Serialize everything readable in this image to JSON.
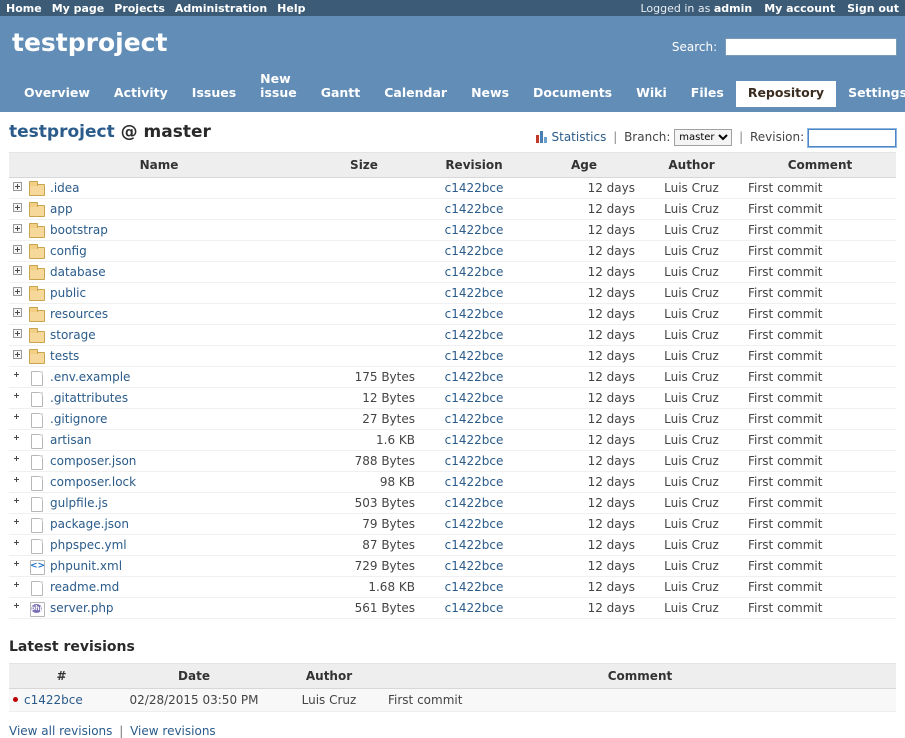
{
  "top_menu": {
    "left_items": [
      {
        "label": "Home",
        "name": "top-menu-home"
      },
      {
        "label": "My page",
        "name": "top-menu-my-page"
      },
      {
        "label": "Projects",
        "name": "top-menu-projects"
      },
      {
        "label": "Administration",
        "name": "top-menu-administration"
      },
      {
        "label": "Help",
        "name": "top-menu-help"
      }
    ],
    "logged_in_prefix": "Logged in as",
    "logged_in_user": "admin",
    "my_account": "My account",
    "sign_out": "Sign out"
  },
  "header": {
    "project_title": "testproject",
    "search_label": "Search:",
    "search_value": "",
    "search_placeholder": ""
  },
  "main_menu": {
    "tabs": [
      {
        "label": "Overview",
        "selected": false
      },
      {
        "label": "Activity",
        "selected": false
      },
      {
        "label": "Issues",
        "selected": false
      },
      {
        "label": "New issue",
        "selected": false
      },
      {
        "label": "Gantt",
        "selected": false
      },
      {
        "label": "Calendar",
        "selected": false
      },
      {
        "label": "News",
        "selected": false
      },
      {
        "label": "Documents",
        "selected": false
      },
      {
        "label": "Wiki",
        "selected": false
      },
      {
        "label": "Files",
        "selected": false
      },
      {
        "label": "Repository",
        "selected": true
      },
      {
        "label": "Settings",
        "selected": false
      }
    ]
  },
  "contextual": {
    "statistics_label": "Statistics",
    "separator": "|",
    "branch_label": "Branch:",
    "branch_value": "master",
    "branch_options": [
      "master"
    ],
    "revision_label": "Revision:",
    "revision_value": "",
    "revision_placeholder": ""
  },
  "page": {
    "title_project": "testproject",
    "title_at": "@",
    "title_ref": "master"
  },
  "dir_table": {
    "columns": [
      "Name",
      "Size",
      "Revision",
      "Age",
      "Author",
      "Comment"
    ],
    "rows": [
      {
        "name": ".idea",
        "kind": "folder",
        "size": "",
        "revision": "c1422bce",
        "age": "12 days",
        "author": "Luis Cruz",
        "comment": "First commit"
      },
      {
        "name": "app",
        "kind": "folder",
        "size": "",
        "revision": "c1422bce",
        "age": "12 days",
        "author": "Luis Cruz",
        "comment": "First commit"
      },
      {
        "name": "bootstrap",
        "kind": "folder",
        "size": "",
        "revision": "c1422bce",
        "age": "12 days",
        "author": "Luis Cruz",
        "comment": "First commit"
      },
      {
        "name": "config",
        "kind": "folder",
        "size": "",
        "revision": "c1422bce",
        "age": "12 days",
        "author": "Luis Cruz",
        "comment": "First commit"
      },
      {
        "name": "database",
        "kind": "folder",
        "size": "",
        "revision": "c1422bce",
        "age": "12 days",
        "author": "Luis Cruz",
        "comment": "First commit"
      },
      {
        "name": "public",
        "kind": "folder",
        "size": "",
        "revision": "c1422bce",
        "age": "12 days",
        "author": "Luis Cruz",
        "comment": "First commit"
      },
      {
        "name": "resources",
        "kind": "folder",
        "size": "",
        "revision": "c1422bce",
        "age": "12 days",
        "author": "Luis Cruz",
        "comment": "First commit"
      },
      {
        "name": "storage",
        "kind": "folder",
        "size": "",
        "revision": "c1422bce",
        "age": "12 days",
        "author": "Luis Cruz",
        "comment": "First commit"
      },
      {
        "name": "tests",
        "kind": "folder",
        "size": "",
        "revision": "c1422bce",
        "age": "12 days",
        "author": "Luis Cruz",
        "comment": "First commit"
      },
      {
        "name": ".env.example",
        "kind": "file",
        "size": "175 Bytes",
        "revision": "c1422bce",
        "age": "12 days",
        "author": "Luis Cruz",
        "comment": "First commit"
      },
      {
        "name": ".gitattributes",
        "kind": "file",
        "size": "12 Bytes",
        "revision": "c1422bce",
        "age": "12 days",
        "author": "Luis Cruz",
        "comment": "First commit"
      },
      {
        "name": ".gitignore",
        "kind": "file",
        "size": "27 Bytes",
        "revision": "c1422bce",
        "age": "12 days",
        "author": "Luis Cruz",
        "comment": "First commit"
      },
      {
        "name": "artisan",
        "kind": "file",
        "size": "1.6 KB",
        "revision": "c1422bce",
        "age": "12 days",
        "author": "Luis Cruz",
        "comment": "First commit"
      },
      {
        "name": "composer.json",
        "kind": "file",
        "size": "788 Bytes",
        "revision": "c1422bce",
        "age": "12 days",
        "author": "Luis Cruz",
        "comment": "First commit"
      },
      {
        "name": "composer.lock",
        "kind": "file",
        "size": "98 KB",
        "revision": "c1422bce",
        "age": "12 days",
        "author": "Luis Cruz",
        "comment": "First commit"
      },
      {
        "name": "gulpfile.js",
        "kind": "file",
        "size": "503 Bytes",
        "revision": "c1422bce",
        "age": "12 days",
        "author": "Luis Cruz",
        "comment": "First commit"
      },
      {
        "name": "package.json",
        "kind": "file",
        "size": "79 Bytes",
        "revision": "c1422bce",
        "age": "12 days",
        "author": "Luis Cruz",
        "comment": "First commit"
      },
      {
        "name": "phpspec.yml",
        "kind": "file",
        "size": "87 Bytes",
        "revision": "c1422bce",
        "age": "12 days",
        "author": "Luis Cruz",
        "comment": "First commit"
      },
      {
        "name": "phpunit.xml",
        "kind": "xml",
        "size": "729 Bytes",
        "revision": "c1422bce",
        "age": "12 days",
        "author": "Luis Cruz",
        "comment": "First commit"
      },
      {
        "name": "readme.md",
        "kind": "file",
        "size": "1.68 KB",
        "revision": "c1422bce",
        "age": "12 days",
        "author": "Luis Cruz",
        "comment": "First commit"
      },
      {
        "name": "server.php",
        "kind": "php",
        "size": "561 Bytes",
        "revision": "c1422bce",
        "age": "12 days",
        "author": "Luis Cruz",
        "comment": "First commit"
      }
    ]
  },
  "latest_revisions": {
    "heading": "Latest revisions",
    "columns": [
      "#",
      "Date",
      "Author",
      "Comment"
    ],
    "rows": [
      {
        "id": "c1422bce",
        "date": "02/28/2015 03:50 PM",
        "author": "Luis Cruz",
        "comment": "First commit"
      }
    ],
    "links": {
      "view_all": "View all revisions",
      "separator": "|",
      "view_revisions": "View revisions"
    }
  },
  "colors": {
    "topbar": "#3b5b77",
    "header": "#628db6",
    "link": "#2a5b8a",
    "table_header": "#eeeeee",
    "revision_bullet": "#bb0000"
  }
}
